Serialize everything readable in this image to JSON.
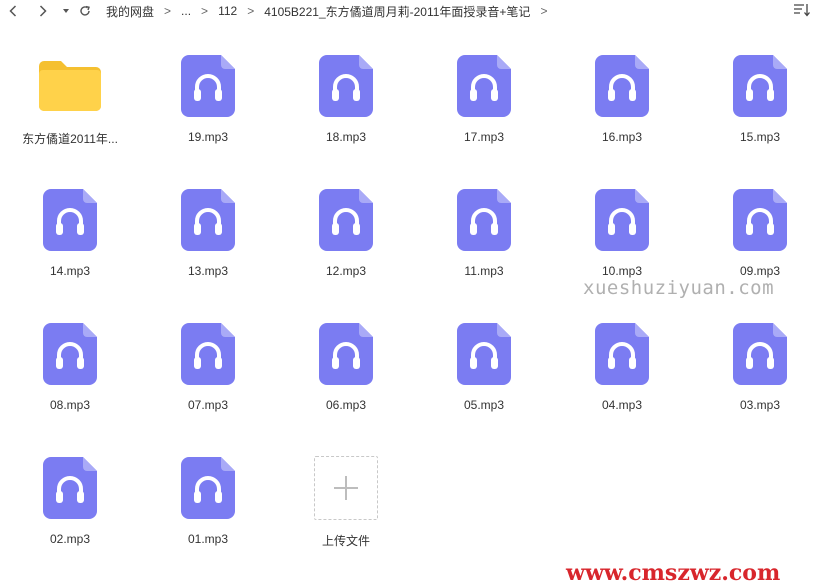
{
  "nav": {
    "back_icon": "chevron-left-icon",
    "forward_icon": "chevron-right-icon",
    "history_icon": "caret-down-icon",
    "refresh_icon": "refresh-icon"
  },
  "breadcrumb": {
    "items": [
      "我的网盘",
      "...",
      "112",
      "4105B221_东方僪道周月莉-2011年面授录音+笔记"
    ],
    "separator": ">"
  },
  "sort_icon": "sort-icon",
  "colors": {
    "audio_icon": "#7b7cf2",
    "folder_icon": "#ffd24a",
    "watermark_red": "#d8262c"
  },
  "files": [
    {
      "name": "东方僪道2011年...",
      "type": "folder"
    },
    {
      "name": "19.mp3",
      "type": "audio"
    },
    {
      "name": "18.mp3",
      "type": "audio"
    },
    {
      "name": "17.mp3",
      "type": "audio"
    },
    {
      "name": "16.mp3",
      "type": "audio"
    },
    {
      "name": "15.mp3",
      "type": "audio"
    },
    {
      "name": "14.mp3",
      "type": "audio"
    },
    {
      "name": "13.mp3",
      "type": "audio"
    },
    {
      "name": "12.mp3",
      "type": "audio"
    },
    {
      "name": "11.mp3",
      "type": "audio"
    },
    {
      "name": "10.mp3",
      "type": "audio"
    },
    {
      "name": "09.mp3",
      "type": "audio"
    },
    {
      "name": "08.mp3",
      "type": "audio"
    },
    {
      "name": "07.mp3",
      "type": "audio"
    },
    {
      "name": "06.mp3",
      "type": "audio"
    },
    {
      "name": "05.mp3",
      "type": "audio"
    },
    {
      "name": "04.mp3",
      "type": "audio"
    },
    {
      "name": "03.mp3",
      "type": "audio"
    },
    {
      "name": "02.mp3",
      "type": "audio"
    },
    {
      "name": "01.mp3",
      "type": "audio"
    }
  ],
  "upload": {
    "label": "上传文件",
    "icon": "plus-icon"
  },
  "watermarks": {
    "site1": "xueshuziyuan.com",
    "site2": "www.cmszwz.com"
  }
}
